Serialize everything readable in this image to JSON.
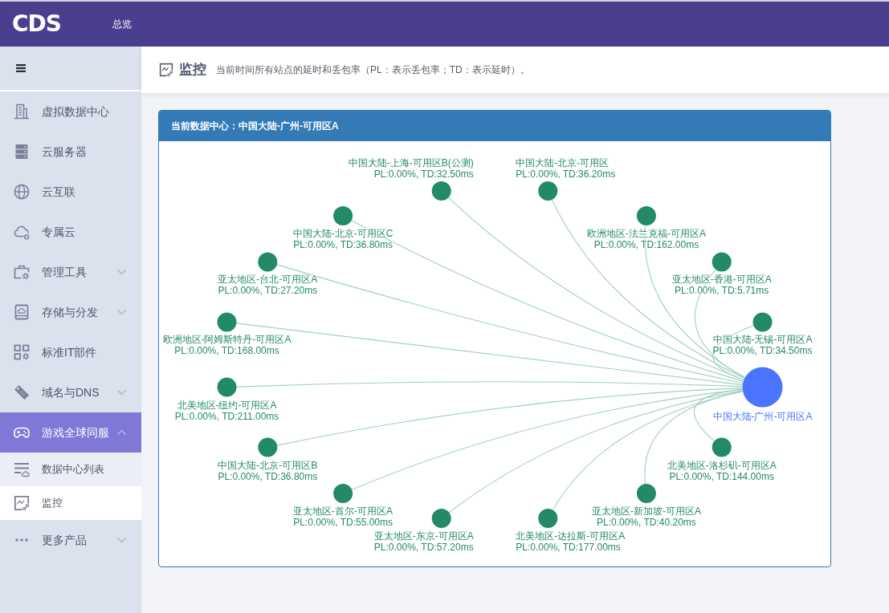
{
  "navbar": {
    "logo": "CDS",
    "links": [
      {
        "label": "总览"
      }
    ]
  },
  "sidebar": {
    "items": [
      {
        "label": "虚拟数据中心",
        "kind": "link",
        "selected": false
      },
      {
        "label": "云服务器",
        "kind": "link",
        "selected": false
      },
      {
        "label": "云互联",
        "kind": "link",
        "selected": false
      },
      {
        "label": "专属云",
        "kind": "link",
        "selected": false
      },
      {
        "label": "管理工具",
        "kind": "group",
        "selected": false,
        "expanded": false
      },
      {
        "label": "存储与分发",
        "kind": "group",
        "selected": false,
        "expanded": false
      },
      {
        "label": "标准IT部件",
        "kind": "link",
        "selected": false
      },
      {
        "label": "域名与DNS",
        "kind": "group",
        "selected": false,
        "expanded": false
      },
      {
        "label": "游戏全球同服",
        "kind": "group",
        "selected": true,
        "expanded": true,
        "children": [
          {
            "label": "数据中心列表",
            "selected": false
          },
          {
            "label": "监控",
            "selected": true
          }
        ]
      },
      {
        "label": "更多产品",
        "kind": "group",
        "selected": false,
        "expanded": false
      }
    ]
  },
  "page_header": {
    "title": "监控",
    "description": "当前时间所有站点的延时和丢包率（PL：表示丢包率；TD：表示延时）。"
  },
  "panel": {
    "title": "当前数据中心：中国大陆-广州-可用区A",
    "graph": {
      "left_arc": [
        {
          "kind": "site",
          "name": "中国大陆-上海-可用区B(公测)",
          "stats": "PL:0.00%, TD:32.50ms"
        },
        {
          "kind": "site",
          "name": "中国大陆-北京-可用区C",
          "stats": "PL:0.00%, TD:36.80ms"
        },
        {
          "kind": "site",
          "name": "亚太地区-台北-可用区A",
          "stats": "PL:0.00%, TD:27.20ms"
        },
        {
          "kind": "site",
          "name": "欧洲地区-阿姆斯特丹-可用区A",
          "stats": "PL:0.00%, TD:168.00ms"
        },
        {
          "kind": "site",
          "name": "北美地区-纽约-可用区A",
          "stats": "PL:0.00%, TD:211.00ms"
        },
        {
          "kind": "site",
          "name": "中国大陆-北京-可用区B",
          "stats": "PL:0.00%, TD:36.80ms"
        },
        {
          "kind": "site",
          "name": "亚太地区-首尔-可用区A",
          "stats": "PL:0.00%, TD:55.00ms"
        },
        {
          "kind": "site",
          "name": "亚太地区-东京-可用区A",
          "stats": "PL:0.00%, TD:57.20ms"
        },
        {
          "kind": "site",
          "name": "北美地区-达拉斯-可用区A",
          "stats": "PL:0.00%, TD:177.00ms"
        }
      ],
      "right_arc": [
        {
          "kind": "site",
          "name": "中国大陆-北京-可用区",
          "stats": "PL:0.00%, TD:36.20ms"
        },
        {
          "kind": "site",
          "name": "欧洲地区-法兰克福-可用区A",
          "stats": "PL:0.00%, TD:162.00ms"
        },
        {
          "kind": "site",
          "name": "亚太地区-香港-可用区A",
          "stats": "PL:0.00%, TD:5.71ms"
        },
        {
          "kind": "site",
          "name": "中国大陆-无锡-可用区A",
          "stats": "PL:0.00%, TD:34.50ms"
        },
        {
          "kind": "current",
          "name": "中国大陆-广州-可用区A"
        },
        {
          "kind": "site",
          "name": "北美地区-洛杉矶-可用区A",
          "stats": "PL:0.00%, TD:144.00ms"
        },
        {
          "kind": "site",
          "name": "亚太地区-新加坡-可用区A",
          "stats": "PL:0.00%, TD:40.20ms"
        }
      ]
    }
  }
}
